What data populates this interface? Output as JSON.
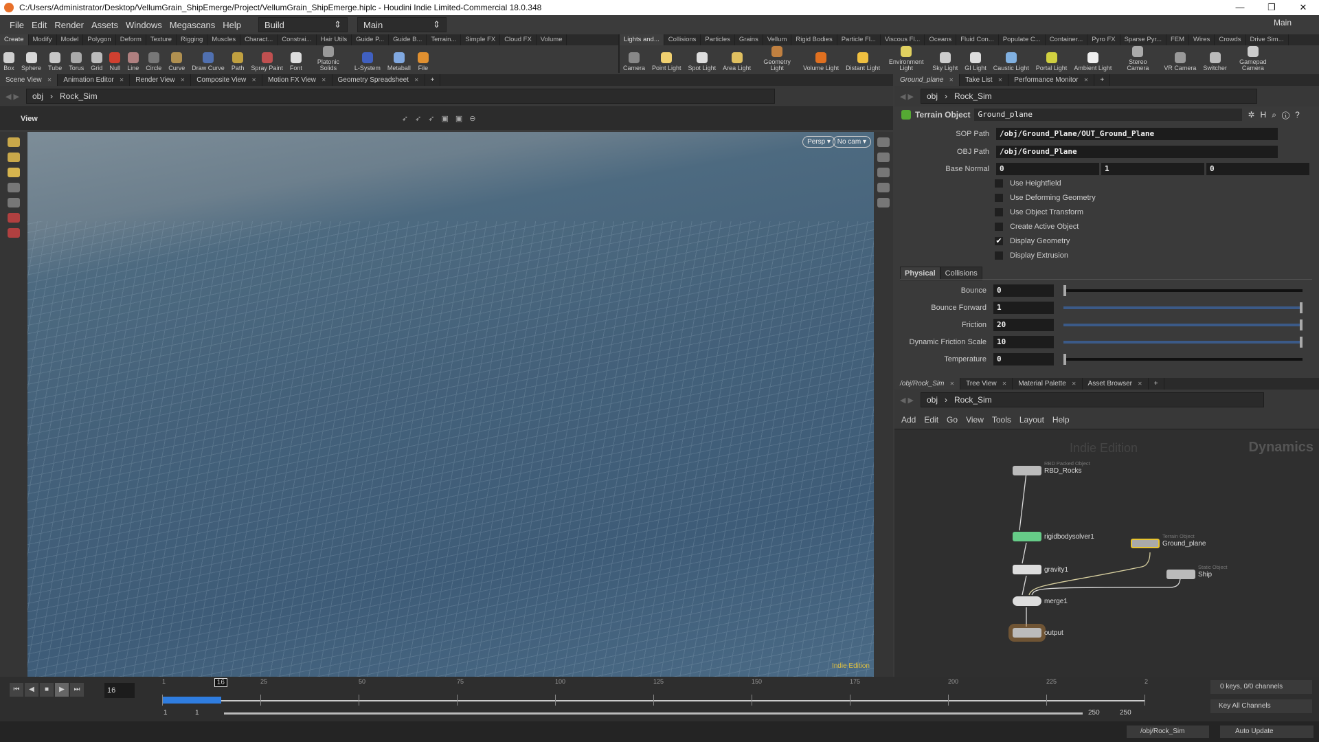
{
  "window": {
    "title": "C:/Users/Administrator/Desktop/VellumGrain_ShipEmerge/Project/VellumGrain_ShipEmerge.hiplc - Houdini Indie Limited-Commercial 18.0.348",
    "minimize": "—",
    "maximize": "❐",
    "close": "✕"
  },
  "menu": {
    "items": [
      "File",
      "Edit",
      "Render",
      "Assets",
      "Windows",
      "Megascans",
      "Help"
    ],
    "desktop": "Build",
    "desktop2": "Main",
    "desktop_right": "Main"
  },
  "shelf_left": {
    "tabs": [
      "Create",
      "Modify",
      "Model",
      "Polygon",
      "Deform",
      "Texture",
      "Rigging",
      "Muscles",
      "Charact...",
      "Constrai...",
      "Hair Utils",
      "Guide P...",
      "Guide B...",
      "Terrain...",
      "Simple FX",
      "Cloud FX",
      "Volume"
    ],
    "tools": [
      {
        "label": "Box",
        "color": "#cfcfcf"
      },
      {
        "label": "Sphere",
        "color": "#d8d8d8"
      },
      {
        "label": "Tube",
        "color": "#c8c8c8"
      },
      {
        "label": "Torus",
        "color": "#aaa"
      },
      {
        "label": "Grid",
        "color": "#bbb"
      },
      {
        "label": "Null",
        "color": "#d04030"
      },
      {
        "label": "Line",
        "color": "#b08080"
      },
      {
        "label": "Circle",
        "color": "#777"
      },
      {
        "label": "Curve",
        "color": "#b09050"
      },
      {
        "label": "Draw Curve",
        "color": "#5070b0"
      },
      {
        "label": "Path",
        "color": "#c0a040"
      },
      {
        "label": "Spray Paint",
        "color": "#c05050"
      },
      {
        "label": "Font",
        "color": "#ddd"
      },
      {
        "label": "Platonic Solids",
        "color": "#999"
      },
      {
        "label": "L-System",
        "color": "#4060c0"
      },
      {
        "label": "Metaball",
        "color": "#80a8e0"
      },
      {
        "label": "File",
        "color": "#e09030"
      }
    ]
  },
  "shelf_right": {
    "tabs": [
      "Lights and...",
      "Collisions",
      "Particles",
      "Grains",
      "Vellum",
      "Rigid Bodies",
      "Particle Fl...",
      "Viscous Fl...",
      "Oceans",
      "Fluid Con...",
      "Populate C...",
      "Container...",
      "Pyro FX",
      "Sparse Pyr...",
      "FEM",
      "Wires",
      "Crowds",
      "Drive Sim..."
    ],
    "tools": [
      {
        "label": "Camera",
        "color": "#888"
      },
      {
        "label": "Point Light",
        "color": "#f0d070"
      },
      {
        "label": "Spot Light",
        "color": "#ddd"
      },
      {
        "label": "Area Light",
        "color": "#e0c060"
      },
      {
        "label": "Geometry Light",
        "color": "#c08040"
      },
      {
        "label": "Volume Light",
        "color": "#e07020"
      },
      {
        "label": "Distant Light",
        "color": "#f0c040"
      },
      {
        "label": "Environment Light",
        "color": "#e0d060"
      },
      {
        "label": "Sky Light",
        "color": "#ccc"
      },
      {
        "label": "GI Light",
        "color": "#ddd"
      },
      {
        "label": "Caustic Light",
        "color": "#80b0e0"
      },
      {
        "label": "Portal Light",
        "color": "#d0d040"
      },
      {
        "label": "Ambient Light",
        "color": "#eee"
      },
      {
        "label": "Stereo Camera",
        "color": "#aaa"
      },
      {
        "label": "VR Camera",
        "color": "#999"
      },
      {
        "label": "Switcher",
        "color": "#bbb"
      },
      {
        "label": "Gamepad Camera",
        "color": "#ccc"
      }
    ]
  },
  "left_pane": {
    "tabs": [
      "Scene View",
      "Animation Editor",
      "Render View",
      "Composite View",
      "Motion FX View",
      "Geometry Spreadsheet"
    ],
    "path": [
      "obj",
      "Rock_Sim"
    ],
    "view_label": "View",
    "persp": "Persp ▾",
    "cam": "No cam ▾",
    "watermark": "Indie Edition"
  },
  "param_pane": {
    "tabs": [
      "Ground_plane",
      "Take List",
      "Performance Monitor"
    ],
    "path": [
      "obj",
      "Rock_Sim"
    ],
    "node_type": "Terrain Object",
    "node_name": "Ground_plane",
    "sop_path_label": "SOP Path",
    "sop_path": "/obj/Ground_Plane/OUT_Ground_Plane",
    "obj_path_label": "OBJ Path",
    "obj_path": "/obj/Ground_Plane",
    "base_normal_label": "Base Normal",
    "base_normal": [
      "0",
      "1",
      "0"
    ],
    "checkboxes": [
      {
        "label": "Use Heightfield",
        "checked": false
      },
      {
        "label": "Use Deforming Geometry",
        "checked": false
      },
      {
        "label": "Use Object Transform",
        "checked": false
      },
      {
        "label": "Create Active Object",
        "checked": false
      },
      {
        "label": "Display Geometry",
        "checked": true
      },
      {
        "label": "Display Extrusion",
        "checked": false
      }
    ],
    "subtabs": [
      "Physical",
      "Collisions"
    ],
    "params": [
      {
        "label": "Bounce",
        "value": "0",
        "fill": 0
      },
      {
        "label": "Bounce Forward",
        "value": "1",
        "fill": 1
      },
      {
        "label": "Friction",
        "value": "20",
        "fill": 1
      },
      {
        "label": "Dynamic Friction Scale",
        "value": "10",
        "fill": 1
      },
      {
        "label": "Temperature",
        "value": "0",
        "fill": 0
      }
    ]
  },
  "network_pane": {
    "tabs": [
      "/obj/Rock_Sim",
      "Tree View",
      "Material Palette",
      "Asset Browser"
    ],
    "path": [
      "obj",
      "Rock_Sim"
    ],
    "menu": [
      "Add",
      "Edit",
      "Go",
      "View",
      "Tools",
      "Layout",
      "Help"
    ],
    "watermark": "Indie Edition",
    "context": "Dynamics",
    "nodes": [
      {
        "name": "RBD_Rocks",
        "type": "RBD Packed Object"
      },
      {
        "name": "rigidbodysolver1",
        "type": ""
      },
      {
        "name": "Ground_plane",
        "type": "Terrain Object"
      },
      {
        "name": "gravity1",
        "type": ""
      },
      {
        "name": "Ship",
        "type": "Static Object"
      },
      {
        "name": "merge1",
        "type": ""
      },
      {
        "name": "output",
        "type": ""
      }
    ]
  },
  "timeline": {
    "current_frame": "16",
    "ticks": [
      "1",
      "25",
      "50",
      "75",
      "100",
      "125",
      "150",
      "175",
      "200",
      "225",
      "2"
    ],
    "start": "1",
    "start2": "1",
    "end": "250",
    "end2": "250",
    "keys_info": "0 keys, 0/0 channels",
    "key_mode": "Key All Channels",
    "progress_fraction": 0.06
  },
  "status": {
    "path": "/obj/Rock_Sim",
    "update": "Auto Update"
  }
}
